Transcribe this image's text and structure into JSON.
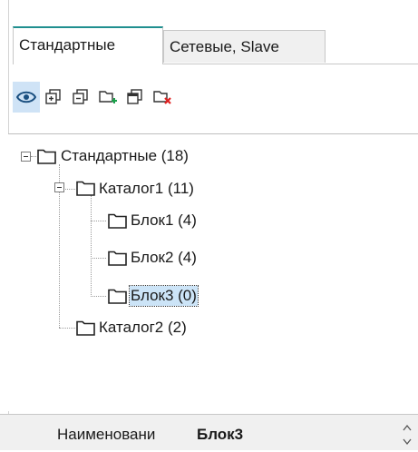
{
  "tabs": [
    {
      "label": "Стандартные",
      "active": true
    },
    {
      "label": "Сетевые, Slave",
      "active": false
    }
  ],
  "toolbar": {
    "buttons": [
      {
        "icon": "eye-icon",
        "active": true
      },
      {
        "icon": "copy-folder-icon"
      },
      {
        "icon": "paste-folder-icon"
      },
      {
        "icon": "add-folder-icon"
      },
      {
        "icon": "duplicate-icon"
      },
      {
        "icon": "delete-folder-icon"
      }
    ]
  },
  "tree": {
    "root": {
      "label": "Стандартные  (18)"
    },
    "catalog1": {
      "label": "Каталог1 (11)"
    },
    "block1": {
      "label": "Блок1 (4)"
    },
    "block2": {
      "label": "Блок2 (4)"
    },
    "block3": {
      "label": "Блок3 (0)",
      "selected": true
    },
    "catalog2": {
      "label": "Каталог2 (2)"
    }
  },
  "properties": {
    "name_label": "Наименовани",
    "name_value": "Блок3"
  },
  "colors": {
    "accent_tab": "#1f8f8f",
    "selection": "#cce4f7",
    "delete_red": "#e02020",
    "add_green": "#1aa04a"
  }
}
